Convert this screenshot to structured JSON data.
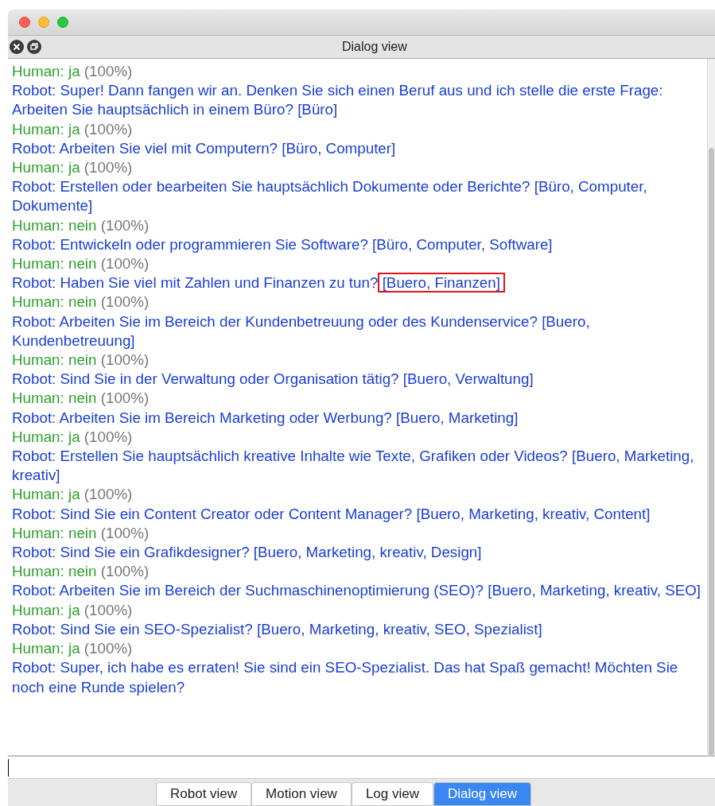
{
  "panel": {
    "title": "Dialog view"
  },
  "messages": [
    {
      "kind": "human",
      "text": "Human: ja",
      "confidence": "(100%)"
    },
    {
      "kind": "robot",
      "text": "Robot: Super! Dann fangen wir an. Denken Sie sich einen Beruf aus und ich stelle die erste Frage:  Arbeiten Sie hauptsächlich in einem Büro?",
      "tags": "[Büro]"
    },
    {
      "kind": "human",
      "text": "Human: ja",
      "confidence": "(100%)"
    },
    {
      "kind": "robot",
      "text": "Robot: Arbeiten Sie viel mit Computern?",
      "tags": "[Büro, Computer]"
    },
    {
      "kind": "human",
      "text": "Human: ja",
      "confidence": "(100%)"
    },
    {
      "kind": "robot",
      "text": "Robot: Erstellen oder bearbeiten Sie hauptsächlich Dokumente oder Berichte?",
      "tags": "[Büro, Computer, Dokumente]"
    },
    {
      "kind": "human",
      "text": "Human: nein",
      "confidence": "(100%)"
    },
    {
      "kind": "robot",
      "text": "Robot: Entwickeln oder programmieren Sie Software?",
      "tags": "[Büro, Computer, Software]"
    },
    {
      "kind": "human",
      "text": "Human: nein",
      "confidence": "(100%)"
    },
    {
      "kind": "robot",
      "text": "Robot: Haben Sie viel mit Zahlen und Finanzen zu tun?",
      "tags": "[Buero, Finanzen]",
      "highlighted": true
    },
    {
      "kind": "human",
      "text": "Human: nein",
      "confidence": "(100%)"
    },
    {
      "kind": "robot",
      "text": "Robot: Arbeiten Sie im Bereich der Kundenbetreuung oder des Kundenservice?",
      "tags": "[Buero, Kundenbetreuung]"
    },
    {
      "kind": "human",
      "text": "Human: nein",
      "confidence": "(100%)"
    },
    {
      "kind": "robot",
      "text": "Robot: Sind Sie in der Verwaltung oder Organisation tätig?",
      "tags": "[Buero, Verwaltung]"
    },
    {
      "kind": "human",
      "text": "Human: nein",
      "confidence": "(100%)"
    },
    {
      "kind": "robot",
      "text": "Robot: Arbeiten Sie im Bereich Marketing oder Werbung?",
      "tags": "[Buero, Marketing]"
    },
    {
      "kind": "human",
      "text": "Human: ja",
      "confidence": "(100%)"
    },
    {
      "kind": "robot",
      "text": "Robot: Erstellen Sie hauptsächlich kreative Inhalte wie Texte, Grafiken oder Videos?",
      "tags": "[Buero, Marketing, kreativ]"
    },
    {
      "kind": "human",
      "text": "Human: ja",
      "confidence": "(100%)"
    },
    {
      "kind": "robot",
      "text": "Robot: Sind Sie ein Content Creator oder Content Manager?",
      "tags": "[Buero, Marketing, kreativ, Content]"
    },
    {
      "kind": "human",
      "text": "Human: nein",
      "confidence": "(100%)"
    },
    {
      "kind": "robot",
      "text": "Robot: Sind Sie ein Grafikdesigner?",
      "tags": "[Buero, Marketing, kreativ, Design]"
    },
    {
      "kind": "human",
      "text": "Human: nein",
      "confidence": "(100%)"
    },
    {
      "kind": "robot",
      "text": "Robot: Arbeiten Sie im Bereich der Suchmaschinenoptimierung (SEO)?",
      "tags": "[Buero, Marketing, kreativ, SEO]"
    },
    {
      "kind": "human",
      "text": "Human: ja",
      "confidence": "(100%)"
    },
    {
      "kind": "robot",
      "text": "Robot: Sind Sie ein SEO-Spezialist?",
      "tags": "[Buero, Marketing, kreativ, SEO, Spezialist]"
    },
    {
      "kind": "human",
      "text": "Human: ja",
      "confidence": "(100%)"
    },
    {
      "kind": "robot",
      "text": "Robot: Super, ich habe es erraten! Sie sind ein SEO-Spezialist. Das hat Spaß gemacht! Möchten Sie noch eine Runde spielen?"
    }
  ],
  "tabs": [
    {
      "label": "Robot view",
      "selected": false
    },
    {
      "label": "Motion view",
      "selected": false
    },
    {
      "label": "Log view",
      "selected": false
    },
    {
      "label": "Dialog view",
      "selected": true
    }
  ]
}
